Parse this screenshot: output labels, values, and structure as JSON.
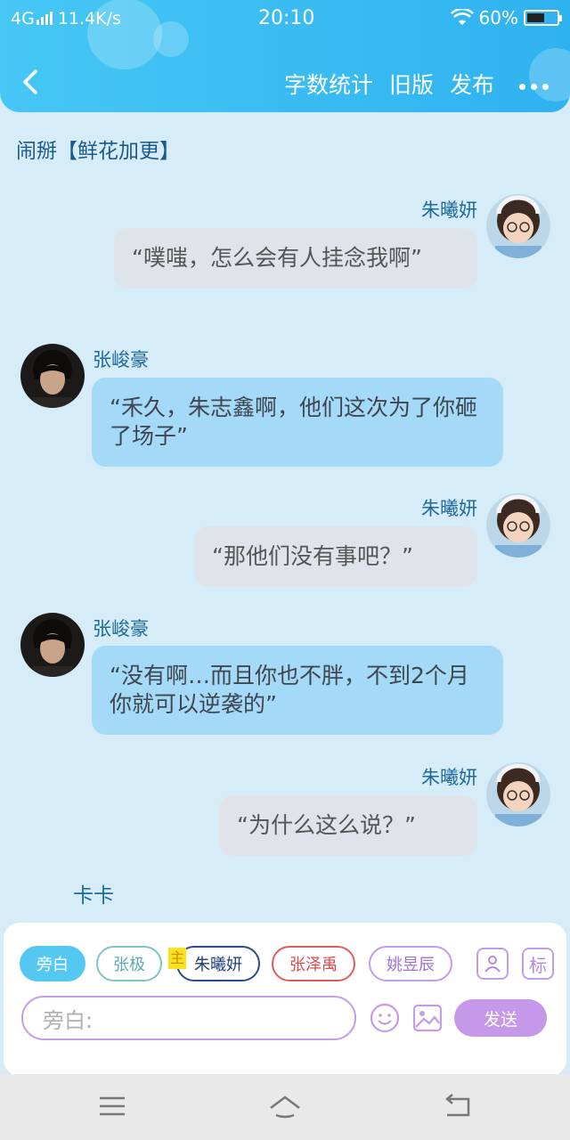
{
  "status_bar": {
    "network": "4G",
    "speed": "11.4K/s",
    "time": "20:10",
    "battery": "60%",
    "battery_level": 0.6
  },
  "header": {
    "back_icon": "chevron-left-icon",
    "menu": {
      "word_count": "字数统计",
      "old_version": "旧版",
      "publish": "发布"
    },
    "more_icon": "more-dots-icon",
    "accent": "#2fb2f0"
  },
  "chapter_title": "闹掰【鲜花加更】",
  "messages": [
    {
      "speaker": "朱曦妍",
      "side": "right",
      "text": "“噗嗤，怎么会有人挂念我啊”"
    },
    {
      "speaker": "张峻豪",
      "side": "left",
      "text": "“禾久，朱志鑫啊，他们这次为了你砸了场子”"
    },
    {
      "speaker": "朱曦妍",
      "side": "right",
      "text": "“那他们没有事吧？”"
    },
    {
      "speaker": "张峻豪",
      "side": "left",
      "text": "“没有啊…而且你也不胖，不到2个月你就可以逆袭的”"
    },
    {
      "speaker": "朱曦妍",
      "side": "right",
      "text": "“为什么这么说？”"
    }
  ],
  "typing_indicator": "卡卡",
  "composer": {
    "roles": [
      "旁白",
      "张极",
      "朱曦妍",
      "张泽禹",
      "姚昱辰"
    ],
    "main_tag": "主",
    "role_icon_label": "标",
    "input_placeholder": "旁白:",
    "send_label": "发送"
  }
}
